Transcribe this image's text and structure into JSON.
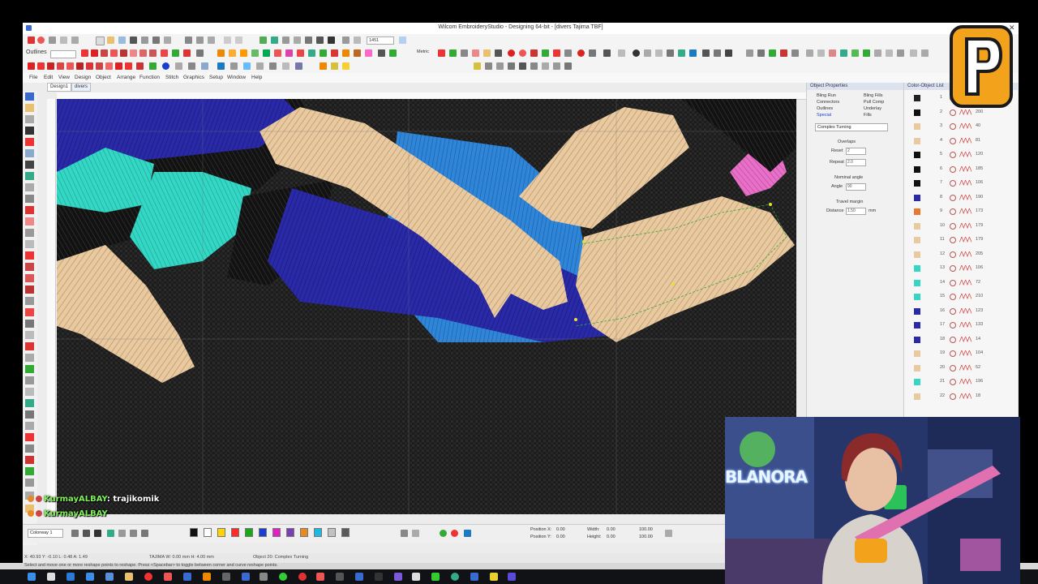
{
  "window": {
    "title": "Wilcom EmbroideryStudio - Designing 64-bit - [divers     Tajima TBF]",
    "close_glyph": "✕"
  },
  "toolbar": {
    "outlines_label": "Outlines",
    "zoom_value": "1451",
    "metric_label": "Metric"
  },
  "menu": [
    "File",
    "Edit",
    "View",
    "Design",
    "Object",
    "Arrange",
    "Function",
    "Stitch",
    "Graphics",
    "Setup",
    "Window",
    "Help"
  ],
  "tabs": [
    "Design1",
    "divers"
  ],
  "object_properties": {
    "header": "Object Properties",
    "tabs": [
      "Bling Run",
      "Bling Fills",
      "Connectors",
      "Pull Comp",
      "Outlines",
      "Underlay",
      "Special",
      "Fills"
    ],
    "stitch_type": "Complex Turning",
    "overlaps_label": "Overlaps",
    "reset_label": "Reset",
    "reset_value": "2",
    "repeat_label": "Repeat",
    "repeat_value": "2.0",
    "nominal_angle_label": "Nominal angle",
    "angle_label": "Angle",
    "angle_value": "90",
    "travel_margin_label": "Travel margin",
    "distance_label": "Distance",
    "distance_value": "1.50",
    "unit": "mm"
  },
  "color_object_list": {
    "header": "Color-Object List",
    "rows": [
      {
        "n": "1",
        "v": "651",
        "c": "#222222"
      },
      {
        "n": "2",
        "v": "200",
        "c": "#111111"
      },
      {
        "n": "3",
        "v": "40",
        "c": "#e8c9a0"
      },
      {
        "n": "4",
        "v": "81",
        "c": "#e8c9a0"
      },
      {
        "n": "5",
        "v": "120",
        "c": "#111111"
      },
      {
        "n": "6",
        "v": "185",
        "c": "#111111"
      },
      {
        "n": "7",
        "v": "106",
        "c": "#111111"
      },
      {
        "n": "8",
        "v": "190",
        "c": "#2a2aa8"
      },
      {
        "n": "9",
        "v": "173",
        "c": "#e87a30"
      },
      {
        "n": "10",
        "v": "179",
        "c": "#e8c9a0"
      },
      {
        "n": "11",
        "v": "179",
        "c": "#e8c9a0"
      },
      {
        "n": "12",
        "v": "205",
        "c": "#e8c9a0"
      },
      {
        "n": "13",
        "v": "106",
        "c": "#34d6c4"
      },
      {
        "n": "14",
        "v": "72",
        "c": "#34d6c4"
      },
      {
        "n": "15",
        "v": "210",
        "c": "#34d6c4"
      },
      {
        "n": "16",
        "v": "123",
        "c": "#2a2aa8"
      },
      {
        "n": "17",
        "v": "133",
        "c": "#2a2aa8"
      },
      {
        "n": "18",
        "v": "14",
        "c": "#2a2aa8"
      },
      {
        "n": "19",
        "v": "104",
        "c": "#e8c9a0"
      },
      {
        "n": "20",
        "v": "52",
        "c": "#e8c9a0"
      },
      {
        "n": "21",
        "v": "196",
        "c": "#34d6c4"
      },
      {
        "n": "22",
        "v": "18",
        "c": "#e8c9a0"
      }
    ]
  },
  "bottom_bar": {
    "colorway": "Colorway 1",
    "position_x_label": "Position X:",
    "position_x_value": "0.00",
    "position_y_label": "Position Y:",
    "position_y_value": "0.00",
    "width_label": "Width:",
    "width_value": "0.00",
    "height_label": "Height:",
    "height_value": "0.00",
    "scale_w": "100.00",
    "scale_h": "100.00",
    "unit": "mm"
  },
  "palette": [
    "#111111",
    "#ffffff",
    "#ffd400",
    "#ff2a2a",
    "#18a818",
    "#1a3fd0",
    "#e020c0",
    "#7a3fb0",
    "#e88a20",
    "#1eb8e0",
    "#c2c2c2",
    "#5a5a5a"
  ],
  "statusbar": {
    "coords": "X: 40.93  Y: -0.10  L: 0.48  A: 1.49",
    "stitch_info": "TAJIMA  W: 0.00 mm  H: 4.00 mm",
    "object_info": "Object 20: Complex Turning",
    "hint": "Select and move one or more reshape points to reshape. Press <Spacebar> to toggle between corner and curve reshape points."
  },
  "chat": {
    "line1_user": "KurmayALBAY",
    "line1_text": ": trajikomik",
    "line2_user": "KurmayALBAY"
  },
  "webcam": {
    "sign_text": "BLANORA"
  },
  "stream_logo": {
    "letter": "P"
  },
  "colors": {
    "tan": "#e8c9a0",
    "navy": "#2a2aa8",
    "cyan": "#34d6c4",
    "blue": "#2f86d8",
    "pink": "#e870c8",
    "fabric": "#1a1a1a",
    "logo_orange": "#f2a21b"
  }
}
